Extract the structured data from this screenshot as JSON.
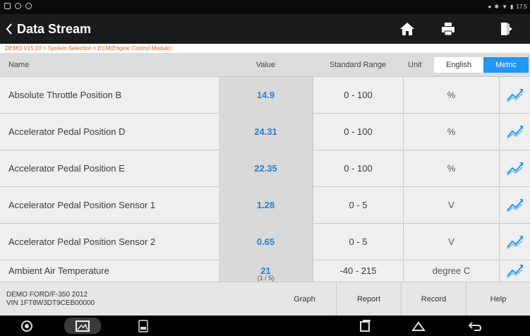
{
  "status_bar": {
    "time": "17:5"
  },
  "header": {
    "title": "Data Stream"
  },
  "breadcrumb": "DEMO V15.10 > System Selection > ECM(Engine Control Module)",
  "columns": {
    "name": "Name",
    "value": "Value",
    "range": "Standard Range",
    "unit": "Unit"
  },
  "unit_toggle": {
    "english": "English",
    "metric": "Metric",
    "selected": "Metric"
  },
  "rows": [
    {
      "name": "Absolute Throttle Position B",
      "value": "14.9",
      "range": "0 - 100",
      "unit": "%"
    },
    {
      "name": "Accelerator Pedal Position D",
      "value": "24.31",
      "range": "0 - 100",
      "unit": "%"
    },
    {
      "name": "Accelerator Pedal Position E",
      "value": "22.35",
      "range": "0 - 100",
      "unit": "%"
    },
    {
      "name": "Accelerator Pedal Position Sensor 1",
      "value": "1.28",
      "range": "0 - 5",
      "unit": "V"
    },
    {
      "name": "Accelerator Pedal Position Sensor 2",
      "value": "0.65",
      "range": "0 - 5",
      "unit": "V"
    },
    {
      "name": "Ambient Air Temperature",
      "value": "21",
      "range": "-40 - 215",
      "unit": "degree C"
    }
  ],
  "pagination": "(1 / 5)",
  "footer": {
    "vehicle_line1": "DEMO FORD/F-350 2012",
    "vehicle_line2": "VIN 1FT8W3DT9CEB00000",
    "buttons": {
      "graph": "Graph",
      "report": "Report",
      "record": "Record",
      "help": "Help"
    }
  },
  "icons": {
    "home": "home-icon",
    "print": "print-icon",
    "exit": "exit-icon",
    "graph": "line-chart-icon"
  },
  "colors": {
    "accent": "#2196f3",
    "value_text": "#2a7fd0",
    "breadcrumb": "#e2611c"
  }
}
